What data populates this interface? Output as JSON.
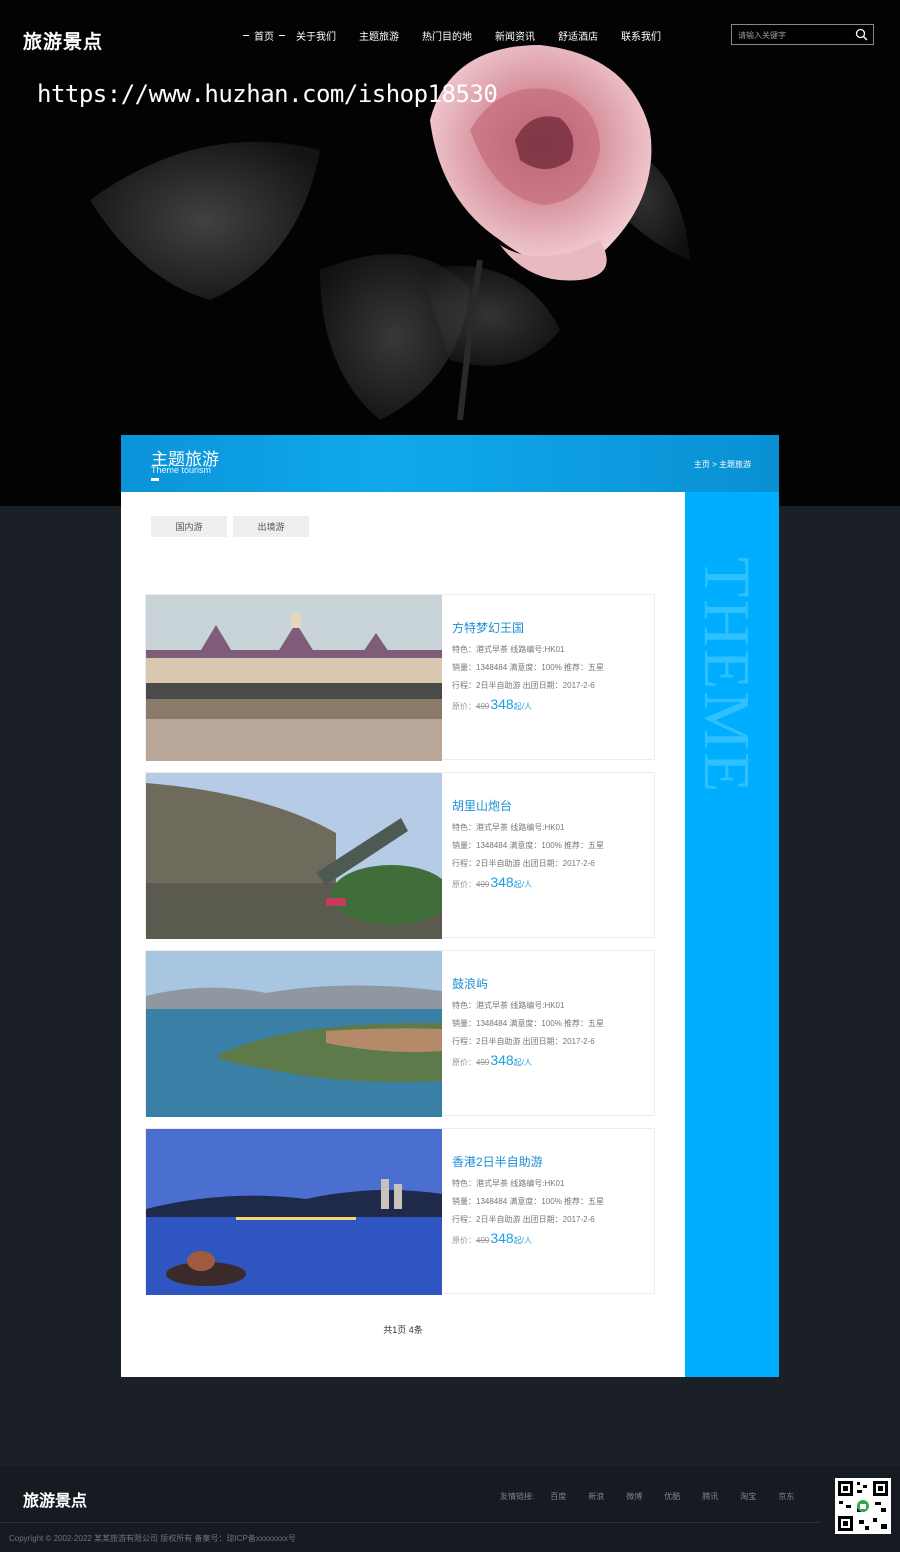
{
  "site": {
    "logo": "旅游景点",
    "watermark": "https://www.huzhan.com/ishop18530"
  },
  "nav": {
    "items": [
      "首页",
      "关于我们",
      "主题旅游",
      "热门目的地",
      "新闻资讯",
      "舒适酒店",
      "联系我们"
    ]
  },
  "search": {
    "placeholder": "请输入关键字"
  },
  "section": {
    "title": "主题旅游",
    "subtitle": "Theme tourism",
    "breadcrumb_home": "主页",
    "breadcrumb_sep": ">",
    "breadcrumb_current": "主题旅游",
    "side_text": "THEME"
  },
  "tabs": [
    "国内游",
    "出境游"
  ],
  "tours": [
    {
      "name": "方特梦幻王国",
      "feature": "特色：港式早茶 线路编号:HK01",
      "stats": "销量：1348484 满意度：100% 推荐：五星",
      "trip": "行程：2日半自助游 出团日期：2017-2-6",
      "old_label": "原价：",
      "old_price": "499",
      "price": "348",
      "unit": "起/人"
    },
    {
      "name": "胡里山炮台",
      "feature": "特色：港式早茶 线路编号:HK01",
      "stats": "销量：1348484 满意度：100% 推荐：五星",
      "trip": "行程：2日半自助游 出团日期：2017-2-6",
      "old_label": "原价：",
      "old_price": "499",
      "price": "348",
      "unit": "起/人"
    },
    {
      "name": "鼓浪屿",
      "feature": "特色：港式早茶 线路编号:HK01",
      "stats": "销量：1348484 满意度：100% 推荐：五星",
      "trip": "行程：2日半自助游 出团日期：2017-2-6",
      "old_label": "原价：",
      "old_price": "499",
      "price": "348",
      "unit": "起/人"
    },
    {
      "name": "香港2日半自助游",
      "feature": "特色：港式早茶 线路编号:HK01",
      "stats": "销量：1348484 满意度：100% 推荐：五星",
      "trip": "行程：2日半自助游 出团日期：2017-2-6",
      "old_label": "原价：",
      "old_price": "499",
      "price": "348",
      "unit": "起/人"
    }
  ],
  "pager": {
    "text": "共1页 4条"
  },
  "footer": {
    "logo": "旅游景点",
    "links_label": "友情链接:",
    "links": [
      "百度",
      "新浪",
      "微博",
      "优酷",
      "腾讯",
      "淘宝",
      "京东"
    ],
    "copyright": "Copyright © 2002-2022 某某旅游有限公司 版权所有 备案号：琼ICP备xxxxxxxx号"
  },
  "colors": {
    "accent": "#00aeff",
    "header_blue": "#0a93d8",
    "link_blue": "#1a8fd6",
    "footer_bg": "#161a21"
  },
  "icons": {
    "search": "search-icon",
    "qr": "qr-code"
  }
}
